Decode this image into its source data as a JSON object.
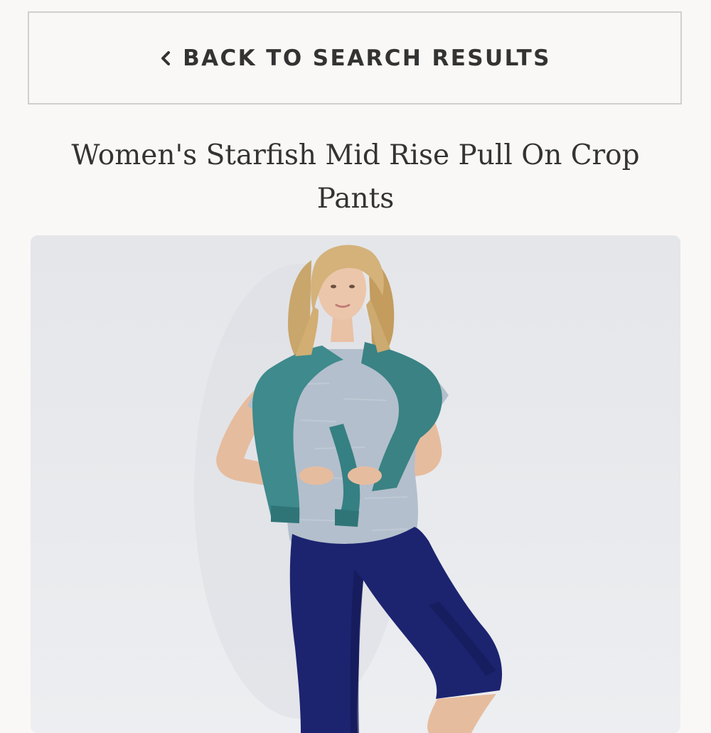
{
  "back_button": {
    "label": "BACK TO SEARCH RESULTS",
    "icon": "chevron-left-icon"
  },
  "product": {
    "title": "Women's Starfish Mid Rise Pull On Crop Pants",
    "image_alt": "Model wearing a heather grey t-shirt, teal sweatshirt tied over shoulders, and navy mid rise crop pants"
  },
  "colors": {
    "background": "#f9f8f6",
    "text": "#333333",
    "border": "#cfcfcf",
    "pants": "#1c2470",
    "sweater": "#3e8a8c",
    "tee": "#b3bfcc"
  }
}
